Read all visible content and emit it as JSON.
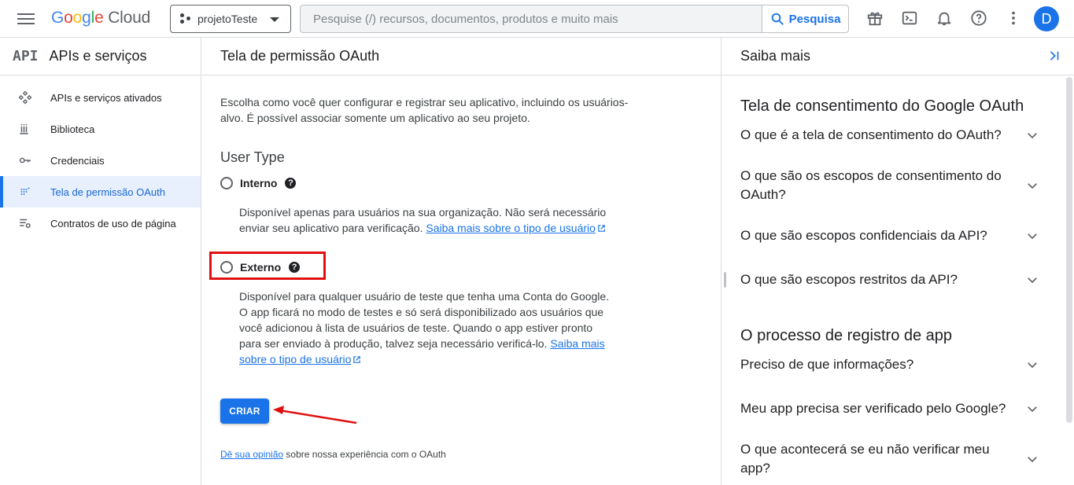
{
  "topbar": {
    "brand_google": "Google",
    "brand_cloud": "Cloud",
    "project": "projetoTeste",
    "search_placeholder": "Pesquise (/) recursos, documentos, produtos e muito mais",
    "search_button": "Pesquisa",
    "avatar_letter": "D",
    "icons": [
      "gift-icon",
      "terminal-icon",
      "bell-icon",
      "help-icon",
      "more-vert-icon"
    ]
  },
  "leftnav": {
    "logo_text": "API",
    "title": "APIs e serviços",
    "items": [
      {
        "label": "APIs e serviços ativados",
        "icon": "apis-icon"
      },
      {
        "label": "Biblioteca",
        "icon": "library-icon"
      },
      {
        "label": "Credenciais",
        "icon": "key-icon"
      },
      {
        "label": "Tela de permissão OAuth",
        "icon": "oauth-icon",
        "active": true
      },
      {
        "label": "Contratos de uso de página",
        "icon": "settings-list-icon"
      }
    ]
  },
  "main": {
    "title": "Tela de permissão OAuth",
    "intro": "Escolha como você quer configurar e registrar seu aplicativo, incluindo os usuários-alvo. É possível associar somente um aplicativo ao seu projeto.",
    "user_type_heading": "User Type",
    "interno": {
      "label": "Interno",
      "desc": "Disponível apenas para usuários na sua organização. Não será necessário enviar seu aplicativo para verificação.",
      "link": "Saiba mais sobre o tipo de usuário"
    },
    "externo": {
      "label": "Externo",
      "desc": "Disponível para qualquer usuário de teste que tenha uma Conta do Google. O app ficará no modo de testes e só será disponibilizado aos usuários que você adicionou à lista de usuários de teste. Quando o app estiver pronto para ser enviado à produção, talvez seja necessário verificá-lo.",
      "link": "Saiba mais sobre o tipo de usuário"
    },
    "create_button": "CRIAR",
    "feedback_link": "Dê sua opinião",
    "feedback_text": "sobre nossa experiência com o OAuth"
  },
  "right": {
    "title": "Saiba mais",
    "section1_title": "Tela de consentimento do Google OAuth",
    "section1_items": [
      "O que é a tela de consentimento do OAuth?",
      "O que são os escopos de consentimento do OAuth?",
      "O que são escopos confidenciais da API?",
      "O que são escopos restritos da API?"
    ],
    "section2_title": "O processo de registro de app",
    "section2_items": [
      "Preciso de que informações?",
      "Meu app precisa ser verificado pelo Google?",
      "O que acontecerá se eu não verificar meu app?"
    ]
  },
  "colors": {
    "accent": "#1a73e8",
    "annotation_red": "#e01010"
  }
}
